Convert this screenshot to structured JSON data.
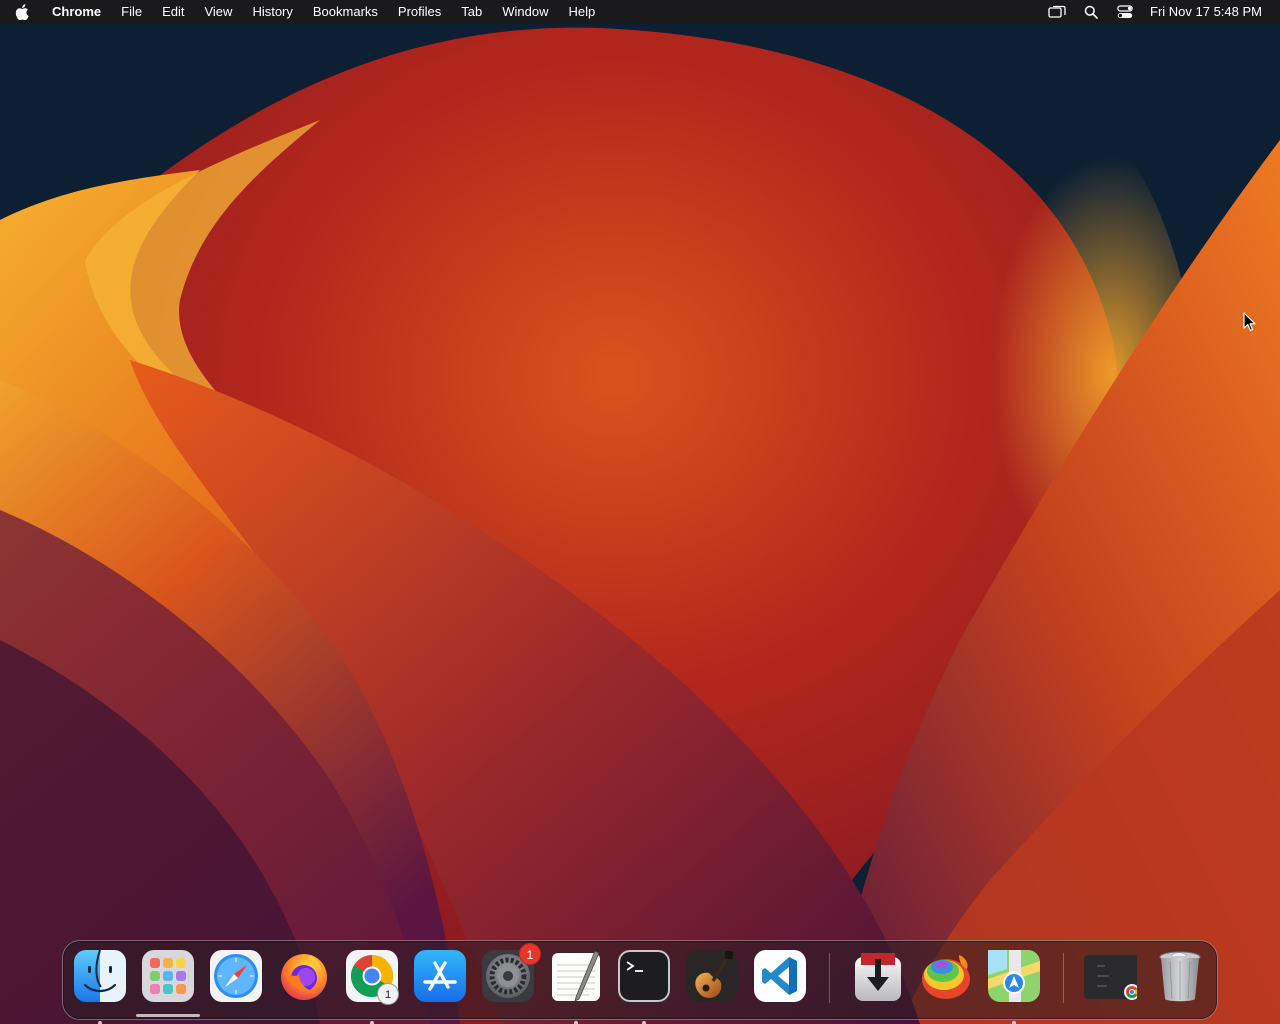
{
  "menubar": {
    "app_name": "Chrome",
    "items": [
      "File",
      "Edit",
      "View",
      "History",
      "Bookmarks",
      "Profiles",
      "Tab",
      "Window",
      "Help"
    ],
    "clock": "Fri Nov 17  5:48 PM",
    "status_icons": [
      "screen-mirroring-icon",
      "spotlight-search-icon",
      "control-center-icon"
    ]
  },
  "dock": {
    "apps": [
      {
        "name": "Finder",
        "icon": "finder-icon",
        "running": true
      },
      {
        "name": "Launchpad",
        "icon": "launchpad-icon",
        "running": false
      },
      {
        "name": "Safari",
        "icon": "safari-icon",
        "running": false
      },
      {
        "name": "Firefox",
        "icon": "firefox-icon",
        "running": false
      },
      {
        "name": "Google Chrome",
        "icon": "chrome-icon",
        "running": true,
        "window_count": "1"
      },
      {
        "name": "App Store",
        "icon": "app-store-icon",
        "running": false
      },
      {
        "name": "System Settings",
        "icon": "system-settings-icon",
        "running": false,
        "badge": "1"
      },
      {
        "name": "TextEdit",
        "icon": "textedit-icon",
        "running": true
      },
      {
        "name": "Terminal",
        "icon": "terminal-icon",
        "running": true
      },
      {
        "name": "GarageBand",
        "icon": "garageband-icon",
        "running": false
      },
      {
        "name": "Visual Studio Code",
        "icon": "vscode-icon",
        "running": false
      },
      {
        "name": "Transmission",
        "icon": "download-icon",
        "running": false
      },
      {
        "name": "Candy Crush",
        "icon": "candy-icon",
        "running": false
      },
      {
        "name": "Maps",
        "icon": "maps-icon",
        "running": true
      },
      {
        "name": "Chrome Window",
        "icon": "chrome-window-thumbnail-icon",
        "running": false
      },
      {
        "name": "Trash",
        "icon": "trash-icon",
        "running": false
      }
    ]
  },
  "colors": {
    "menubar": "#1a1a1c",
    "wallpaper_bg": "#0d1f33",
    "wallpaper_orange": "#e8761c",
    "wallpaper_red": "#b5281c",
    "wallpaper_purple": "#5b1a3e",
    "badge_red": "#e8362f"
  }
}
